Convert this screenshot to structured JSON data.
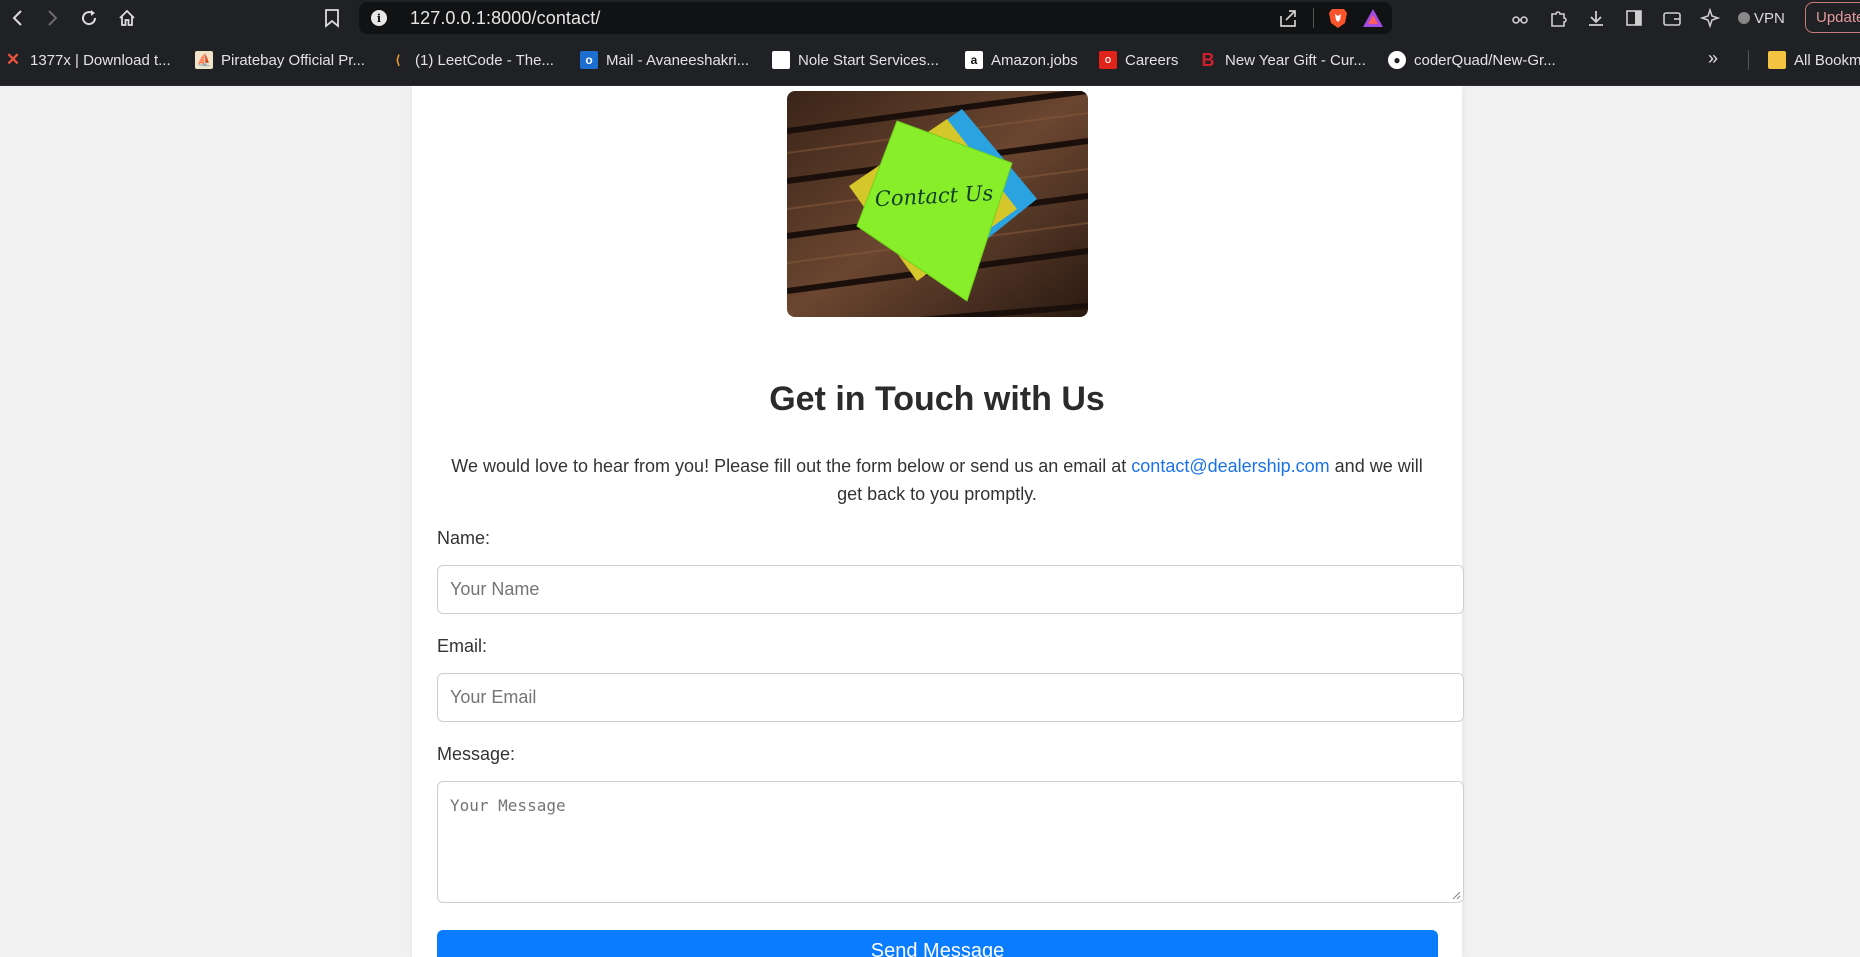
{
  "browser": {
    "url": "127.0.0.1:8000/contact/",
    "vpn_label": "VPN",
    "update_label": "Update"
  },
  "bookmarks": [
    {
      "label": "1377x | Download t...",
      "icon": "x-icon",
      "color": "#e8543c"
    },
    {
      "label": "Piratebay Official Pr...",
      "icon": "ship-icon",
      "color": "#f1e4c8"
    },
    {
      "label": "(1) LeetCode - The...",
      "icon": "leetcode-icon",
      "color": "#f0a22e"
    },
    {
      "label": "Mail - Avaneeshakri...",
      "icon": "outlook-icon",
      "color": "#1c6fd1"
    },
    {
      "label": "Nole Start Services...",
      "icon": "blank-page-icon",
      "color": "#ffffff"
    },
    {
      "label": "Amazon.jobs",
      "icon": "amazon-icon",
      "color": "#ffffff"
    },
    {
      "label": "Careers",
      "icon": "oracle-icon",
      "color": "#e2231a"
    },
    {
      "label": "New Year Gift - Cur...",
      "icon": "b-logo-icon",
      "color": "#d01f2b"
    },
    {
      "label": "coderQuad/New-Gr...",
      "icon": "github-icon",
      "color": "#ffffff"
    }
  ],
  "bookmarks_more": "»",
  "all_bookmarks": "All Bookm",
  "page": {
    "hero_text": "Contact Us",
    "title": "Get in Touch with Us",
    "intro_before": "We would love to hear from you! Please fill out the form below or send us an email at ",
    "intro_link": "contact@dealership.com",
    "intro_after": " and we will get back to you promptly.",
    "form": {
      "name_label": "Name:",
      "name_placeholder": "Your Name",
      "email_label": "Email:",
      "email_placeholder": "Your Email",
      "message_label": "Message:",
      "message_placeholder": "Your Message",
      "submit_label": "Send Message"
    }
  },
  "colors": {
    "accent": "#0a7cff",
    "link": "#1a73e8",
    "toolbar": "#202124"
  }
}
